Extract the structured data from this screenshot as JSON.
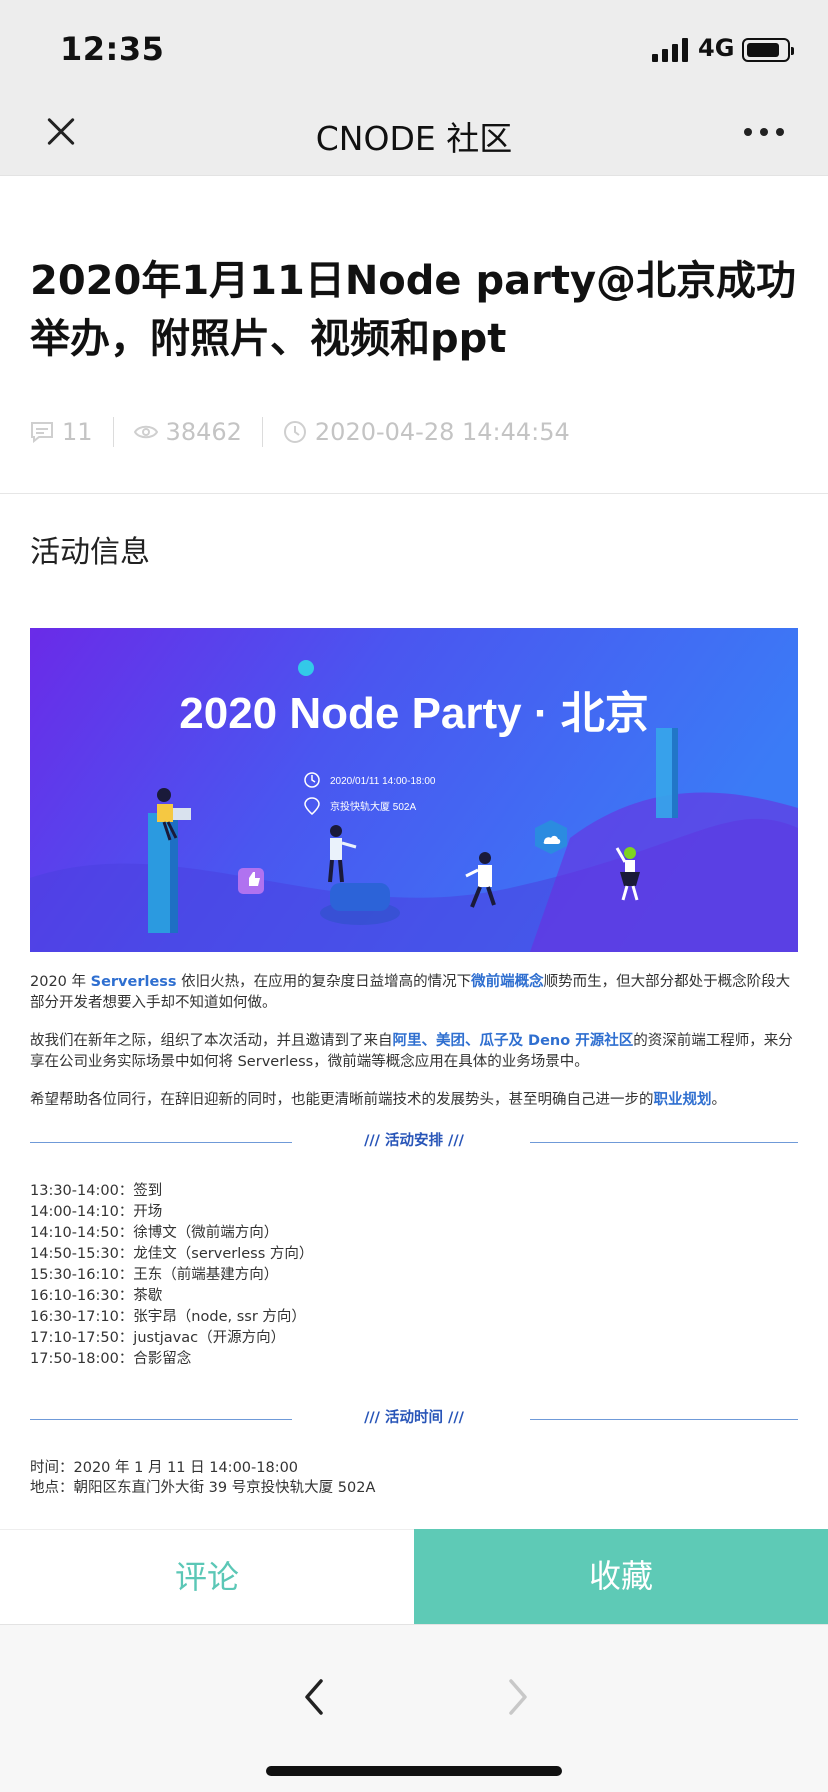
{
  "status": {
    "time": "12:35",
    "network": "4G",
    "battery_level": 0.85
  },
  "nav": {
    "title": "CNODE 社区",
    "close_icon": "close-icon",
    "more_icon": "more-icon"
  },
  "article": {
    "title": "2020年1月11日Node party@北京成功举办，附照片、视频和ppt",
    "replies": "11",
    "views": "38462",
    "date": "2020-04-28 14:44:54",
    "section": "活动信息"
  },
  "banner": {
    "title": "2020 Node Party · 北京",
    "time": "2020/01/11  14:00-18:00",
    "location": "京投快轨大厦  502A",
    "colors": {
      "start": "#6a2be8",
      "end": "#3b7bf6",
      "accent": "#33c9e8"
    }
  },
  "doc": {
    "p1_a": "2020 年 ",
    "p1_hl1": "Serverless",
    "p1_b": " 依旧火热，在应用的复杂度日益增高的情况下",
    "p1_hl2": "微前端概念",
    "p1_c": "顺势而生，但大部分都处于概念阶段大部分开发者想要入手却不知道如何做。",
    "p2_a": "故我们在新年之际，组织了本次活动，并且邀请到了来自",
    "p2_hl": "阿里、美团、瓜子及 Deno 开源社区",
    "p2_b": "的资深前端工程师，来分享在公司业务实际场景中如何将 Serverless，微前端等概念应用在具体的业务场景中。",
    "p3_a": "希望帮助各位同行，在辞旧迎新的同时，也能更清晰前端技术的发展势头，甚至明确自己进一步的",
    "p3_hl": "职业规划",
    "p3_b": "。",
    "heading1": "/// 活动安排 ///",
    "schedule": [
      "13:30-14:00：签到",
      "14:00-14:10：开场",
      "14:10-14:50：徐博文（微前端方向）",
      "14:50-15:30：龙佳文（serverless 方向）",
      "15:30-16:10：王东（前端基建方向）",
      "16:10-16:30：茶歇",
      "16:30-17:10：张宇昂（node, ssr 方向）",
      "17:10-17:50：justjavac（开源方向）",
      "17:50-18:00：合影留念"
    ],
    "heading2": "/// 活动时间 ///",
    "time_line": "时间：2020 年 1 月 11 日 14:00-18:00",
    "place_line": "地点：朝阳区东直门外大街 39 号京投快轨大厦 502A"
  },
  "actions": {
    "comment": "评论",
    "favorite": "收藏"
  },
  "colors": {
    "accent": "#5ecab6",
    "link": "#2f6fd0",
    "bar": "#ededed"
  }
}
